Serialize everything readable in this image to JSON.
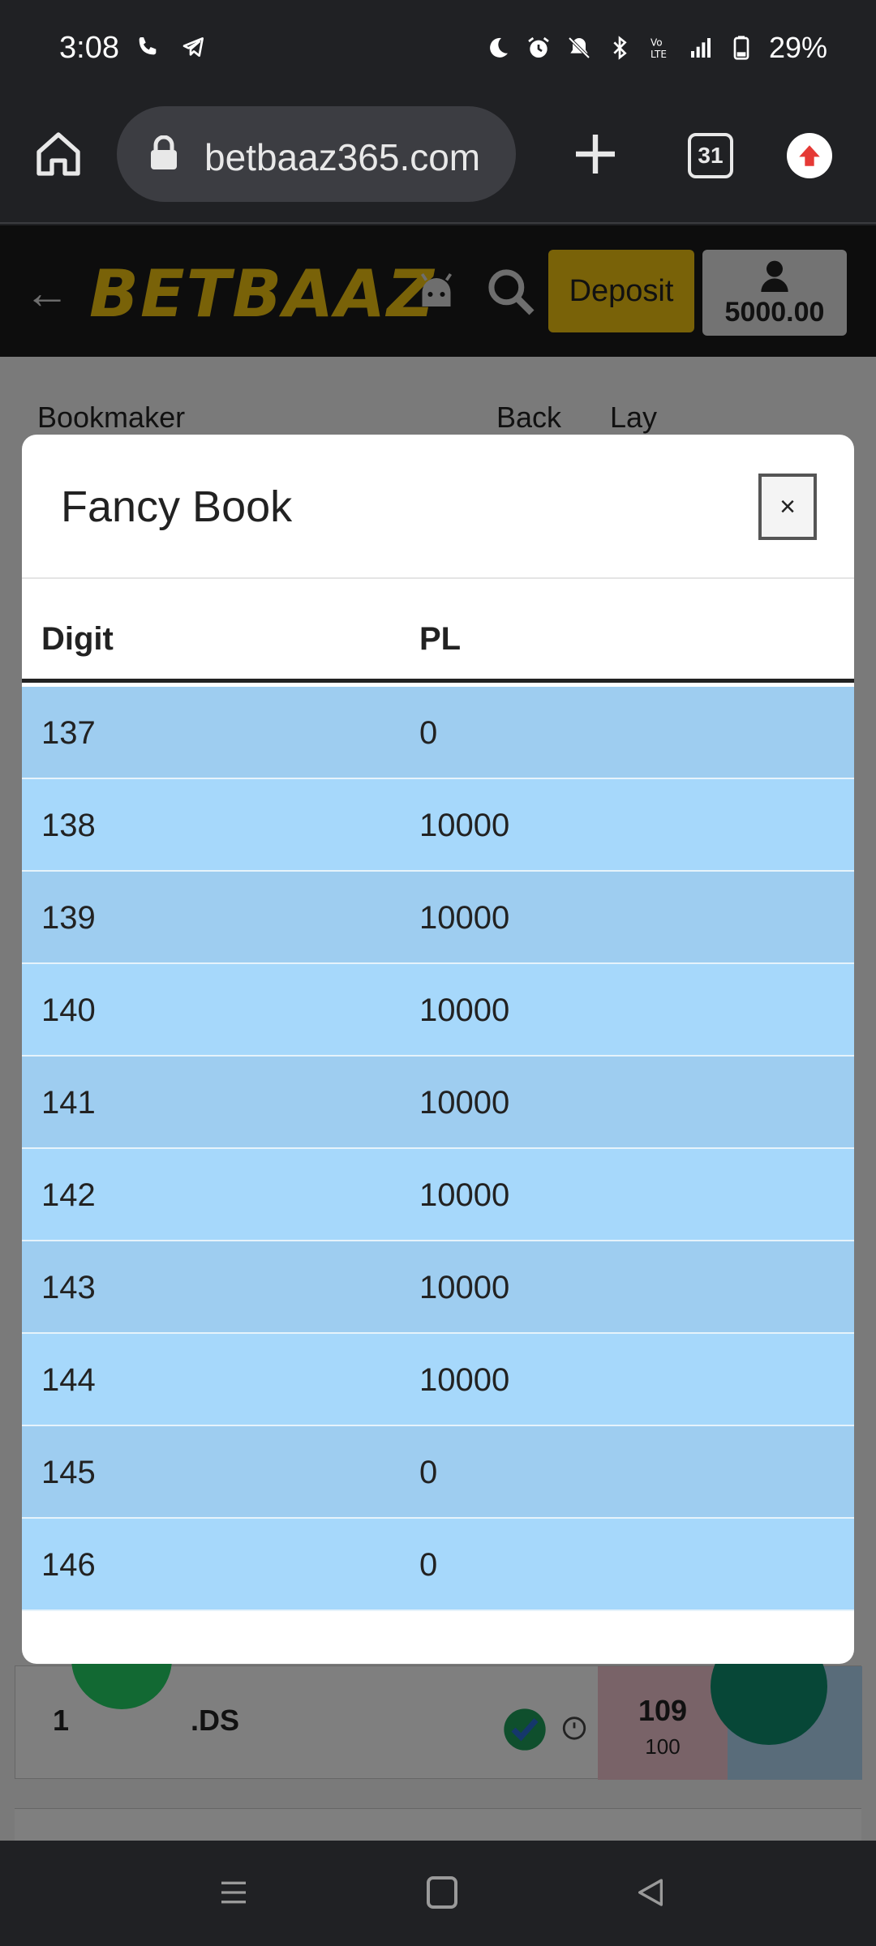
{
  "status_bar": {
    "time": "3:08",
    "battery": "29%",
    "network": "4G"
  },
  "browser": {
    "url": "betbaaz365.com",
    "tab_count": "31"
  },
  "site_header": {
    "logo": "BETBAAZ",
    "deposit_label": "Deposit",
    "balance": "5000.00"
  },
  "page": {
    "bookmaker_label": "Bookmaker",
    "back_label": "Back",
    "lay_label": "Lay",
    "row_name_start": "1",
    "row_name_end": ".DS",
    "back_price": "109",
    "back_size": "100"
  },
  "modal": {
    "title": "Fancy Book",
    "close_label": "×",
    "columns": [
      "Digit",
      "PL"
    ],
    "rows": [
      {
        "digit": "137",
        "pl": "0"
      },
      {
        "digit": "138",
        "pl": "10000"
      },
      {
        "digit": "139",
        "pl": "10000"
      },
      {
        "digit": "140",
        "pl": "10000"
      },
      {
        "digit": "141",
        "pl": "10000"
      },
      {
        "digit": "142",
        "pl": "10000"
      },
      {
        "digit": "143",
        "pl": "10000"
      },
      {
        "digit": "144",
        "pl": "10000"
      },
      {
        "digit": "145",
        "pl": "0"
      },
      {
        "digit": "146",
        "pl": "0"
      }
    ]
  },
  "colors": {
    "row_odd": "#9ecdf0",
    "row_even": "#a6d8fb",
    "brand_yellow": "#f2c511"
  }
}
